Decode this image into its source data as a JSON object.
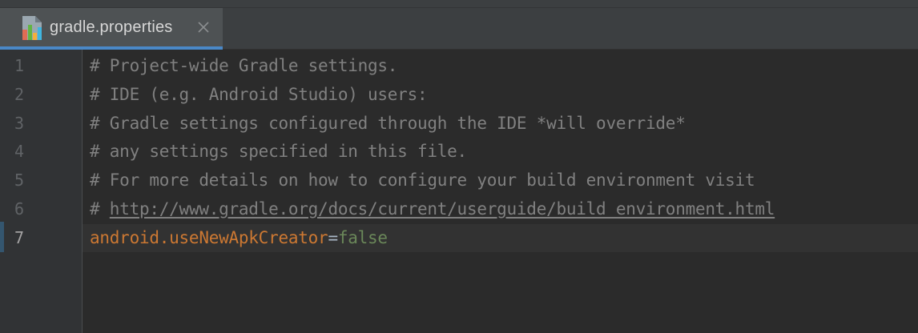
{
  "tab": {
    "label": "gradle.properties",
    "icon": "gradle-file-icon",
    "close_icon": "close-icon",
    "active": true
  },
  "colors": {
    "background": "#2b2b2b",
    "gutter": "#313335",
    "tab_active": "#4e5254",
    "tab_underline": "#4a88c7",
    "comment": "#808080",
    "key": "#cc7832",
    "value": "#6a8759"
  },
  "editor": {
    "current_line": 7,
    "lines": [
      {
        "num": "1",
        "text": "# Project-wide Gradle settings."
      },
      {
        "num": "2",
        "text": "# IDE (e.g. Android Studio) users:"
      },
      {
        "num": "3",
        "text": "# Gradle settings configured through the IDE *will override*"
      },
      {
        "num": "4",
        "text": "# any settings specified in this file."
      },
      {
        "num": "5",
        "text": "# For more details on how to configure your build environment visit"
      },
      {
        "num": "6",
        "prefix": "# ",
        "link": "http://www.gradle.org/docs/current/userguide/build_environment.html"
      },
      {
        "num": "7",
        "key": "android.useNewApkCreator",
        "separator": "=",
        "value": "false"
      }
    ]
  }
}
